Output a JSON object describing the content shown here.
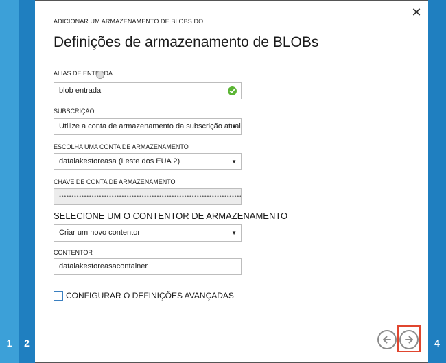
{
  "dialog": {
    "supertitle": "ADICIONAR UM ARMAZENAMENTO DE BLOBS DO",
    "title": "Definições de armazenamento de BLOBs",
    "close_icon": "close-icon"
  },
  "steps": {
    "step1": "1",
    "step2": "2",
    "step4": "4"
  },
  "form": {
    "alias_label": "ALIAS DE ENTRADA",
    "alias_value": "blob entrada",
    "subscription_label": "SUBSCRIÇÃO",
    "subscription_value": "Utilize a conta de armazenamento da subscrição atual",
    "account_label": "ESCOLHA UMA CONTA DE ARMAZENAMENTO",
    "account_value": "datalakestoreasa (Leste dos EUA 2)",
    "key_label": "CHAVE DE CONTA DE ARMAZENAMENTO",
    "key_value": "••••••••••••••••••••••••••••••••••••••••••••••••••••••••••••••••••••••••••••••••••",
    "container_select_label": "SELECIONE UM O CONTENTOR DE ARMAZENAMENTO",
    "container_select_value": "Criar um novo contentor",
    "container_label": "CONTENTOR",
    "container_value": "datalakestoreasacontainer",
    "advanced_label": "CONFIGURAR O DEFINIÇÕES AVANÇADAS"
  },
  "nav": {
    "back_icon": "arrow-left-icon",
    "next_icon": "arrow-right-icon"
  },
  "colors": {
    "rail_light": "#3ca0d8",
    "rail_dark": "#1f7fc0",
    "ok_green": "#5bb534",
    "highlight_red": "#e0462f"
  }
}
